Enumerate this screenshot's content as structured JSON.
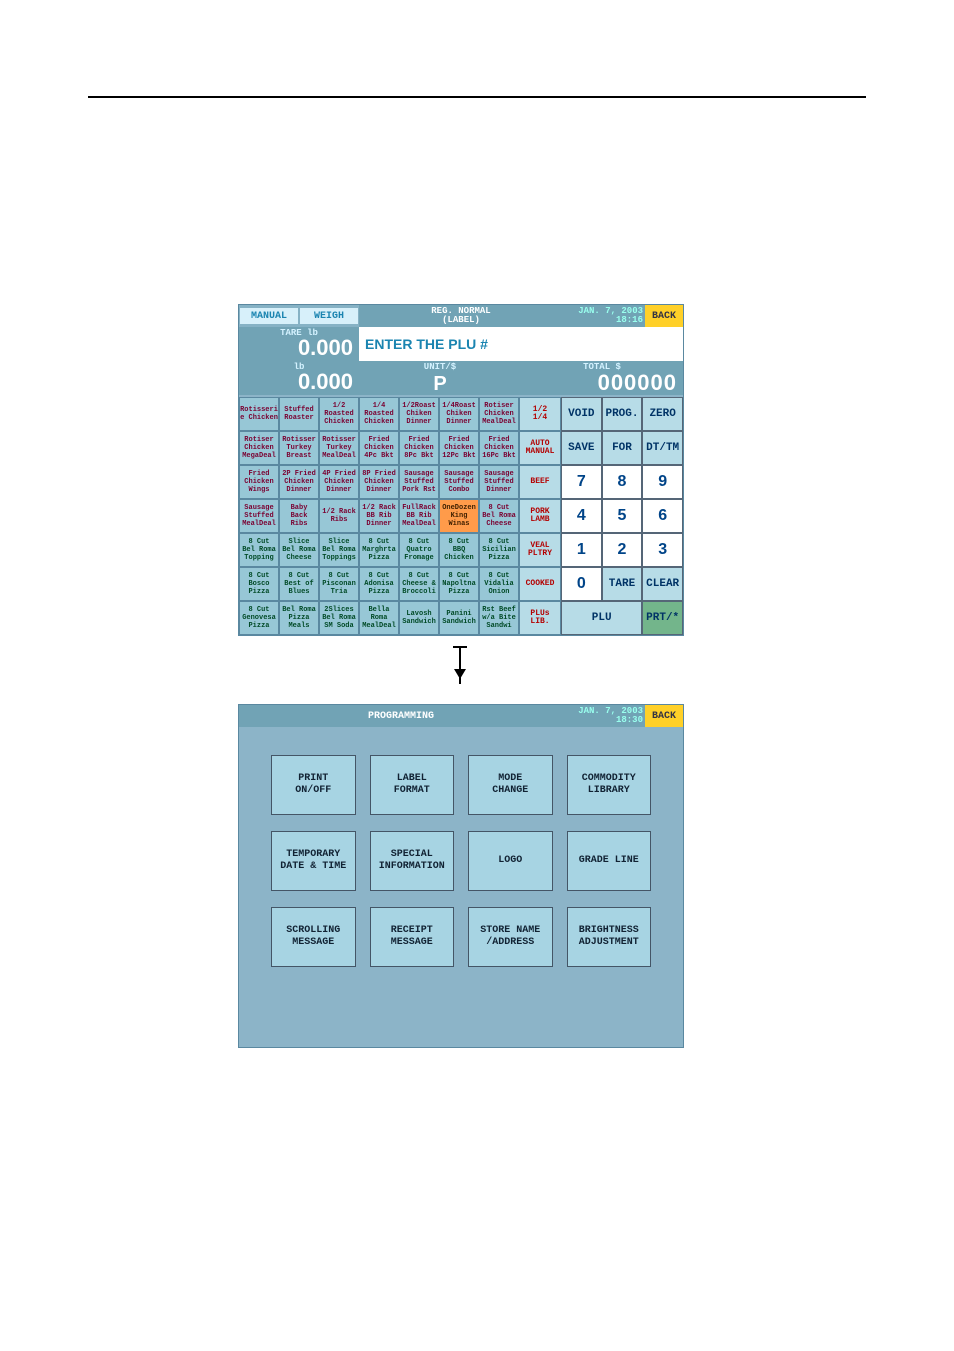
{
  "hr": true,
  "screen1": {
    "top": {
      "manual": "MANUAL",
      "weigh": "WEIGH",
      "reg1": "REG. NORMAL",
      "reg2": "(LABEL)",
      "date1": "JAN.  7, 2003",
      "date2": "18:16",
      "back": "BACK"
    },
    "tare_lbl": "TARE  lb",
    "tare_val": "0.000",
    "plu_prompt": "ENTER THE PLU #",
    "lb_lbl": "lb",
    "lb_val": "0.000",
    "unit_lbl": "UNIT/$",
    "unit_val": "P",
    "tot_lbl": "TOTAL  $",
    "tot_val": "000000",
    "plu_rows": [
      [
        "Rotisseri\ne Chicken",
        "Stuffed\nRoaster",
        "1/2\nRoasted\nChicken",
        "1/4\nRoasted\nChicken",
        "1/2Roast\nChiken\nDinner",
        "1/4Roast\nChiken\nDinner",
        "Rotiser\nChicken\nMealDeal"
      ],
      [
        "Rotiser\nChicken\nMegaDeal",
        "Rotisser\nTurkey\nBreast",
        "Rotisser\nTurkey\nMealDeal",
        "Fried\nChicken\n4Pc Bkt",
        "Fried\nChicken\n8Pc Bkt",
        "Fried\nChicken\n12Pc Bkt",
        "Fried\nChicken\n16Pc Bkt"
      ],
      [
        "Fried\nChicken\nWings",
        "2P Fried\nChicken\nDinner",
        "4P Fried\nChicken\nDinner",
        "8P Fried\nChicken\nDinner",
        "Sausage\nStuffed\nPork Rst",
        "Sausage\nStuffed\nCombo",
        "Sausage\nStuffed\nDinner"
      ],
      [
        "Sausage\nStuffed\nMealDeal",
        "Baby\nBack\nRibs",
        "1/2 Rack\nRibs",
        "1/2 Rack\nBB Rib\nDinner",
        "FullRack\nBB Rib\nMealDeal",
        "OneDozen\nKing\nWinas",
        "8 Cut\nBel Roma\nCheese"
      ],
      [
        "8 Cut\nBel Roma\nTopping",
        "Slice\nBel Roma\nCheese",
        "Slice\nBel Roma\nToppings",
        "8 Cut\nMarghrta\nPizza",
        "8 Cut\nQuatro\nFromage",
        "8 Cut\nBBQ\nChicken",
        "8 Cut\nSicilian\nPizza"
      ],
      [
        "8 Cut\nBosco\nPizza",
        "8 Cut\nBest of\nBlues",
        "8 Cut\nPisconan\nTria",
        "8 Cut\nAdonisa\nPizza",
        "8 Cut\nCheese &\nBroccoli",
        "8 Cut\nNapoltna\nPizza",
        "8 Cut\nVidalia\nOnion"
      ],
      [
        "8 Cut\nGenovesa\nPizza",
        "Bel Roma\nPizza\nMeals",
        "2Slices\nBel Roma\nSM Soda",
        "Bella\nRoma\nMealDeal",
        "Lavosh\nSandwich",
        "Panini\nSandwich",
        "Rst Beef\nw/a Bite\nSandwi"
      ]
    ],
    "navcol": [
      {
        "t": "1/2\n1/4",
        "c": "txt-red"
      },
      {
        "t": "AUTO\nMANUAL",
        "c": "txt-red"
      },
      {
        "t": "BEEF",
        "c": "txt-red"
      },
      {
        "t": "PORK\nLAMB",
        "c": "txt-red"
      },
      {
        "t": "VEAL\nPLTRY",
        "c": "txt-red"
      },
      {
        "t": "COOKED",
        "c": "txt-red"
      },
      {
        "t": "PLUs\nLIB.",
        "c": "txt-red"
      }
    ],
    "keypad": [
      {
        "t": "VOID",
        "c": "bg-pad"
      },
      {
        "t": "PROG.",
        "c": "bg-pad"
      },
      {
        "t": "ZERO",
        "c": "bg-pad"
      },
      {
        "t": "SAVE",
        "c": "bg-pad"
      },
      {
        "t": "FOR",
        "c": "bg-pad"
      },
      {
        "t": "DT/TM",
        "c": "bg-pad"
      },
      {
        "t": "7",
        "c": "bg-white num"
      },
      {
        "t": "8",
        "c": "bg-white num"
      },
      {
        "t": "9",
        "c": "bg-white num"
      },
      {
        "t": "4",
        "c": "bg-white num"
      },
      {
        "t": "5",
        "c": "bg-white num"
      },
      {
        "t": "6",
        "c": "bg-white num"
      },
      {
        "t": "1",
        "c": "bg-white num"
      },
      {
        "t": "2",
        "c": "bg-white num"
      },
      {
        "t": "3",
        "c": "bg-white num"
      },
      {
        "t": "0",
        "c": "bg-white num"
      },
      {
        "t": "TARE",
        "c": "bg-pad"
      },
      {
        "t": "CLEAR",
        "c": "bg-pad"
      },
      {
        "t": "PLU",
        "c": "bg-pad wide2",
        "span": 2
      },
      {
        "t": "PRT/*",
        "c": "bg-grn"
      }
    ]
  },
  "screen2": {
    "title": "PROGRAMMING",
    "date1": "JAN.  7, 2003",
    "date2": "18:30",
    "back": "BACK",
    "buttons": [
      "PRINT\nON/OFF",
      "LABEL\nFORMAT",
      "MODE\nCHANGE",
      "COMMODITY\nLIBRARY",
      "TEMPORARY\nDATE & TIME",
      "SPECIAL\nINFORMATION",
      "LOGO",
      "GRADE LINE",
      "SCROLLING\nMESSAGE",
      "RECEIPT\nMESSAGE",
      "STORE NAME\n/ADDRESS",
      "BRIGHTNESS\nADJUSTMENT"
    ]
  }
}
